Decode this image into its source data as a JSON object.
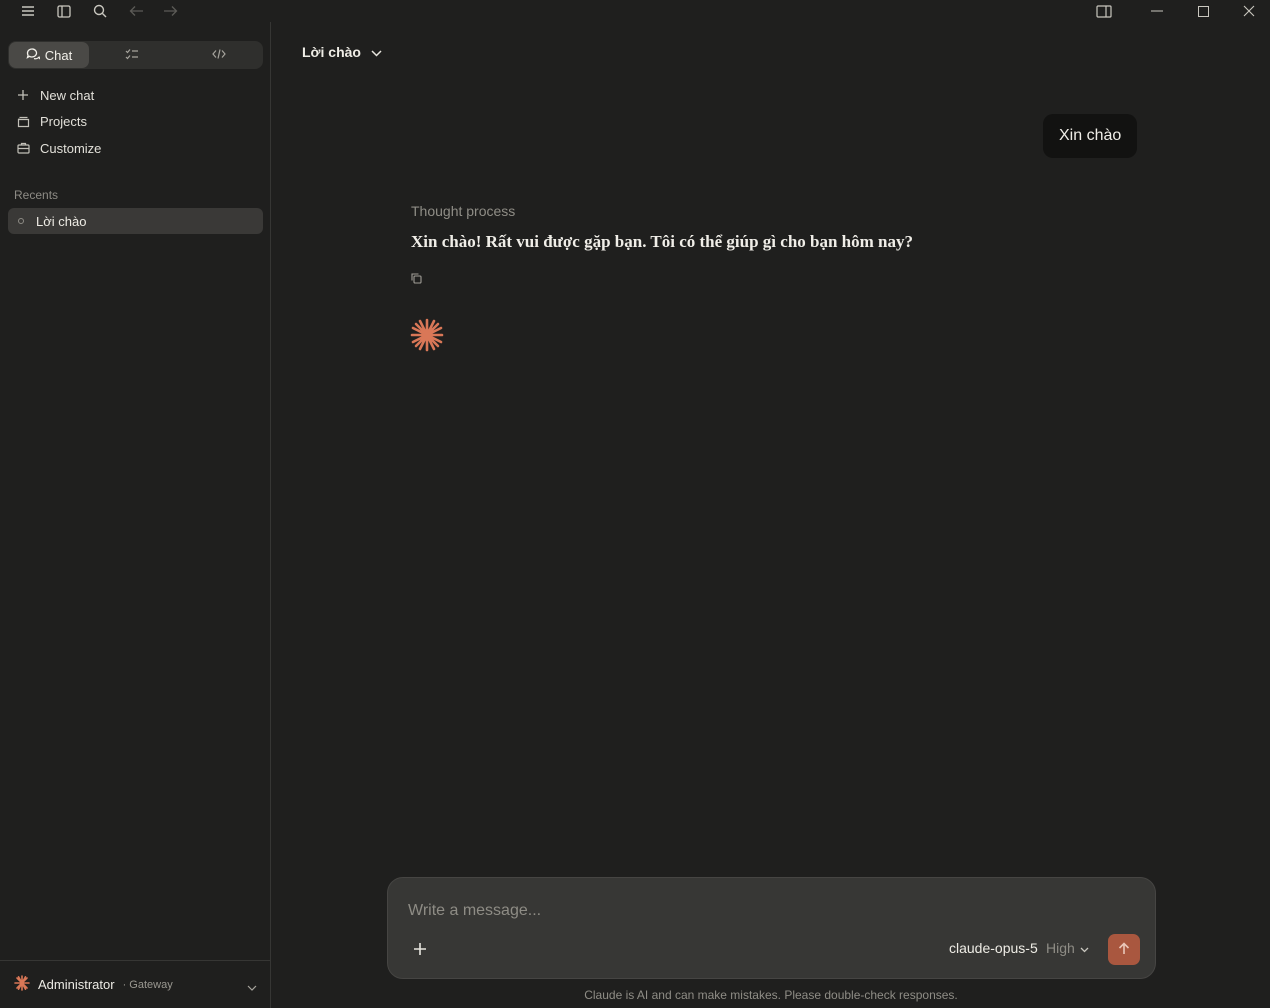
{
  "sidebar": {
    "modes": [
      {
        "label": "Chat",
        "icon": "chat-bubbles-icon"
      },
      {
        "label": "",
        "icon": "task-checklist-icon"
      },
      {
        "label": "",
        "icon": "code-icon"
      }
    ],
    "nav": [
      {
        "label": "New chat",
        "icon": "plus-icon"
      },
      {
        "label": "Projects",
        "icon": "folder-icon"
      },
      {
        "label": "Customize",
        "icon": "briefcase-icon"
      }
    ],
    "recents_label": "Recents",
    "recents": [
      {
        "label": "Lời chào"
      }
    ],
    "user": {
      "name": "Administrator",
      "sub": "· Gateway"
    }
  },
  "conversation": {
    "title": "Lời chào",
    "user_message": "Xin chào",
    "thought_label": "Thought process",
    "reply": "Xin chào! Rất vui được gặp bạn. Tôi có thể giúp gì cho bạn hôm nay?"
  },
  "composer": {
    "placeholder": "Write a message...",
    "model": "claude-opus-5",
    "effort": "High"
  },
  "disclaimer": "Claude is AI and can make mistakes. Please double-check responses.",
  "colors": {
    "accent": "#d97757",
    "send": "#a9573f"
  }
}
